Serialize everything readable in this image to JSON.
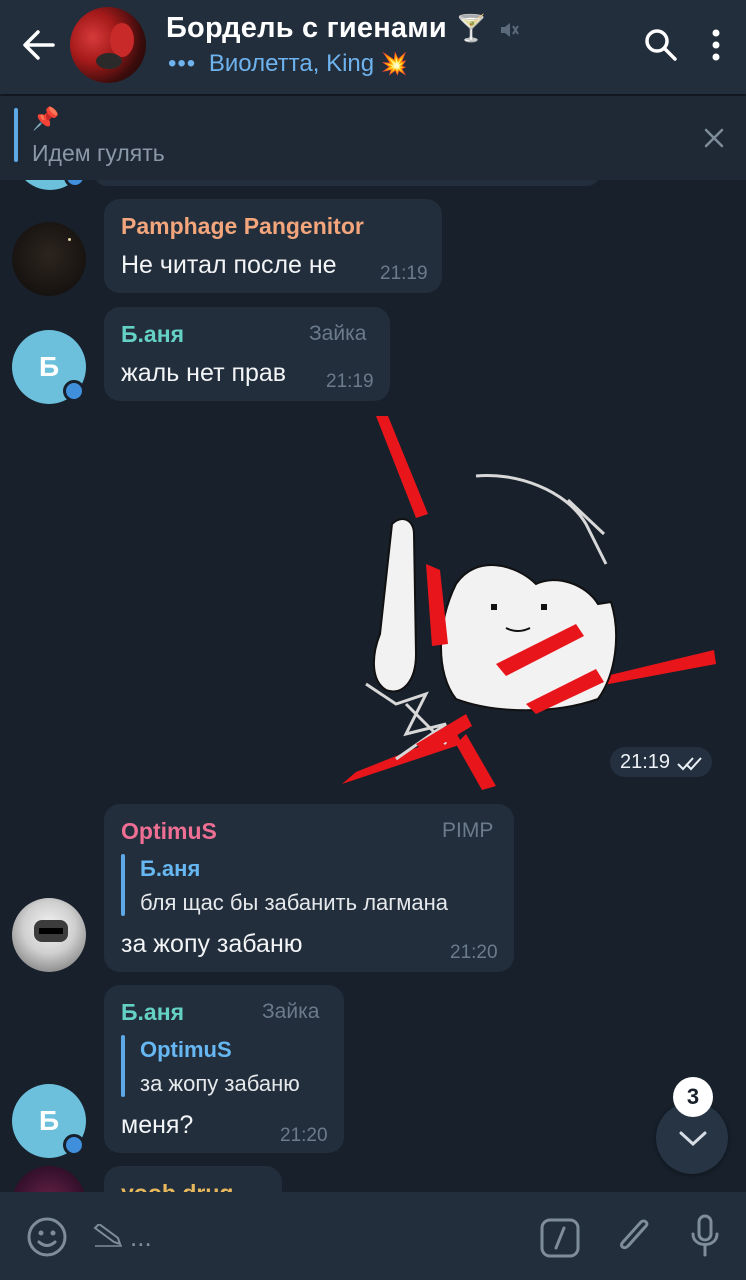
{
  "header": {
    "back_icon": "arrow-left-icon",
    "title": "Бордель с гиенами",
    "title_emoji": "🍸",
    "muted_icon": "mute-icon",
    "subtitle_typing": "•••",
    "subtitle": "Виолетта, King",
    "subtitle_emoji": "💥",
    "search_icon": "search-icon",
    "menu_icon": "more-vert-icon"
  },
  "pinned": {
    "icon": "📌",
    "text": "Идем гулять",
    "close_icon": "close-icon"
  },
  "messages": [
    {
      "name": "Pamphage Pangenitor",
      "text": "Не читал после не",
      "time": "21:19",
      "name_color": "#f3a57c"
    },
    {
      "avatar_letter": "Б",
      "name": "Б.аня",
      "badge": "Зайка",
      "text": "жаль нет прав",
      "time": "21:19",
      "name_color": "#65d0c4"
    },
    {
      "type": "sticker",
      "time": "21:19",
      "status_icon": "double-check-icon"
    },
    {
      "name": "OptimuS",
      "badge": "PIMP",
      "reply_name": "Б.аня",
      "reply_text": "бля щас бы забанить лагмана",
      "text": "за жопу забаню",
      "time": "21:20",
      "name_color": "#ee6f93"
    },
    {
      "avatar_letter": "Б",
      "name": "Б.аня",
      "badge": "Зайка",
      "reply_name": "OptimuS",
      "reply_text": "за жопу забаню",
      "text": "меня?",
      "time": "21:20",
      "name_color": "#65d0c4"
    },
    {
      "name": "yoob drug",
      "name_color": "#e8b85c"
    }
  ],
  "scroll_down": {
    "unread_count": "3",
    "icon": "chevron-down-icon"
  },
  "input": {
    "emoji_icon": "emoji-icon",
    "placeholder_icon": "pencil-icon",
    "placeholder": "...",
    "commands_icon": "slash-command-icon",
    "attach_icon": "paperclip-icon",
    "mic_icon": "microphone-icon"
  }
}
